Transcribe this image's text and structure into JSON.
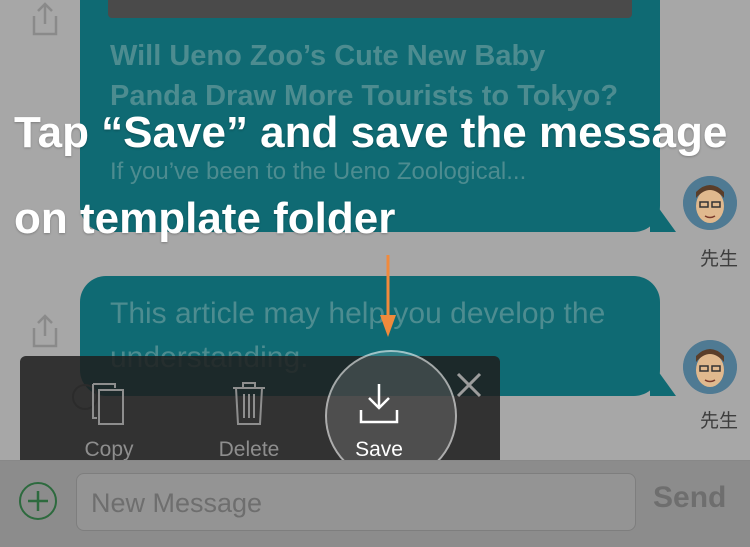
{
  "instruction": {
    "line1": "Tap “Save” and save the message",
    "line2": "on template folder"
  },
  "messages": [
    {
      "title": "Will Ueno Zoo’s Cute New Baby Panda Draw More Tourists to Tokyo?",
      "excerpt": "If you’ve been to the Ueno Zoological...",
      "sender": "先生"
    },
    {
      "body": "This article may help you develop the understanding.",
      "sender": "先生"
    }
  ],
  "actions": {
    "copy": "Copy",
    "delete": "Delete",
    "save": "Save"
  },
  "input": {
    "placeholder": "New Message",
    "send_label": "Send"
  },
  "colors": {
    "bubble": "#0f6a73",
    "arrow": "#f08a3c",
    "overlay_text": "#ffffff"
  },
  "icons": [
    "share-icon",
    "copy-icon",
    "delete-icon",
    "save-icon",
    "close-icon",
    "plus-icon",
    "avatar"
  ]
}
